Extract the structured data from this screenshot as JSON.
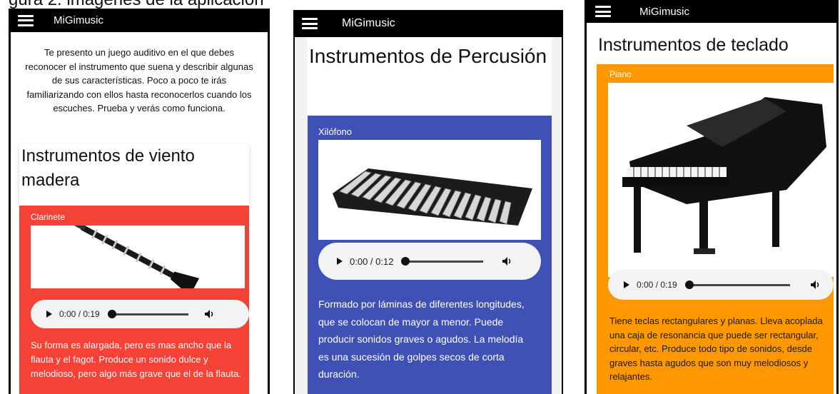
{
  "caption": "gura 2: imágenes de la aplicación",
  "app_name": "MiGimusic",
  "phones": [
    {
      "intro": "Te presento un juego auditivo en el que debes reconocer el instrumento que suena y describir algunas de sus características. Poco a poco te irás familiarizando con ellos hasta reconocerlos cuando los escuches. Prueba y verás como funciona.",
      "section_title": "Instrumentos de viento madera",
      "instrument": "Clarinete",
      "player": {
        "time": "0:00 / 0:19"
      },
      "description": "Su forma es alargada, pero es mas ancho que la flauta y el fagot. Produce un sonido dulce y melodioso, pero algo más grave que el de la flauta.",
      "color": "#f44336"
    },
    {
      "section_title": "Instrumentos de Percusión",
      "instrument": "Xilófono",
      "player": {
        "time": "0:00 / 0:12"
      },
      "description": "Formado por láminas de diferentes longitudes, que se colocan de mayor a menor. Puede producir sonidos graves o agudos. La melodía es una sucesión de golpes secos de corta duración.",
      "color": "#3f51b5"
    },
    {
      "section_title": "Instrumentos de teclado",
      "instrument": "Piano",
      "player": {
        "time": "0:00 / 0:19"
      },
      "description": "Tiene teclas rectangulares y planas. Lleva acoplada una caja de resonancia que puede ser rectangular, circular, etc. Produce todo tipo de sonidos, desde graves hasta agudos que son muy melodiosos y relajantes.",
      "color": "#ff9800"
    }
  ]
}
